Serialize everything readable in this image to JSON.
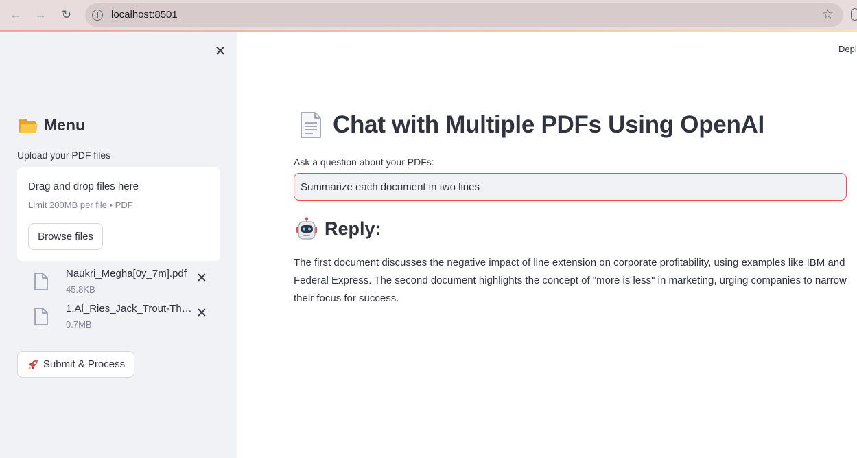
{
  "browser": {
    "url": "localhost:8501"
  },
  "sidebar": {
    "menu_title": "Menu",
    "upload_label": "Upload your PDF files",
    "dropzone": {
      "title": "Drag and drop files here",
      "limit": "Limit 200MB per file • PDF",
      "browse_label": "Browse files"
    },
    "files": [
      {
        "name": "Naukri_Megha[0y_7m].pdf",
        "size": "45.8KB"
      },
      {
        "name": "1.Al_Ries_Jack_Trout-Th…",
        "size": "0.7MB"
      }
    ],
    "submit_label": "Submit & Process",
    "icons": {
      "menu": "folder-icon",
      "submit": "rocket-icon",
      "file": "file-icon"
    }
  },
  "header": {
    "deploy_label": "Depl"
  },
  "main": {
    "title": "Chat with Multiple PDFs Using OpenAI",
    "title_icon": "document-icon",
    "question_label": "Ask a question about your PDFs:",
    "question_value": "Summarize each document in two lines",
    "reply_title": "Reply:",
    "reply_icon": "robot-icon",
    "reply_text": "The first document discusses the negative impact of line extension on corporate profitability, using examples like IBM and Federal Express. The second document highlights the concept of \"more is less\" in marketing, urging companies to narrow their focus for success."
  },
  "colors": {
    "accent": "#ff4b4b",
    "sidebar_bg": "#f0f2f6",
    "text": "#31333f",
    "muted": "#808495"
  }
}
